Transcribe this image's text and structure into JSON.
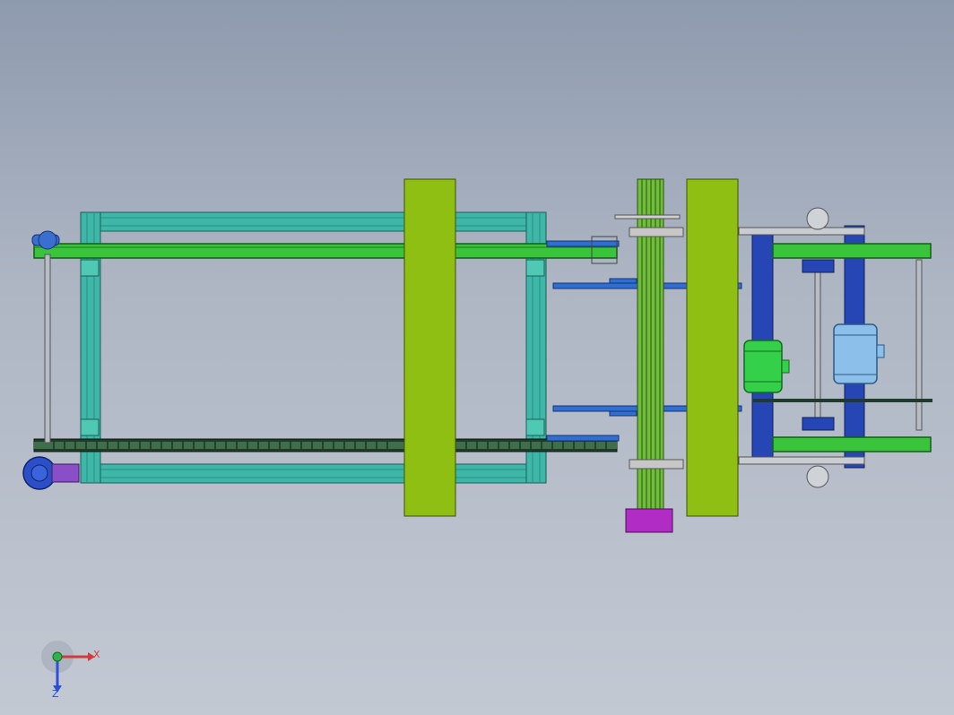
{
  "viewport": {
    "background_top": "#8e9aae",
    "background_bottom": "#c3c9d3"
  },
  "colors": {
    "frame_cyan": "#3fb7a8",
    "frame_cyan_dark": "#2a8c80",
    "rail_green": "#39c43c",
    "plate_olive": "#8fbf12",
    "stand_blue": "#2646b5",
    "motor_green": "#35d04a",
    "motor_blue": "#8cc0ea",
    "gear_purple": "#a23fc0",
    "arm_blue": "#2f6fd0",
    "chain_dark": "#1f3b2a"
  },
  "triad": {
    "x_label": "X",
    "z_label": "Z",
    "x_color": "#d23b3b",
    "y_color": "#2fb34a",
    "z_color": "#2b4fd6"
  }
}
